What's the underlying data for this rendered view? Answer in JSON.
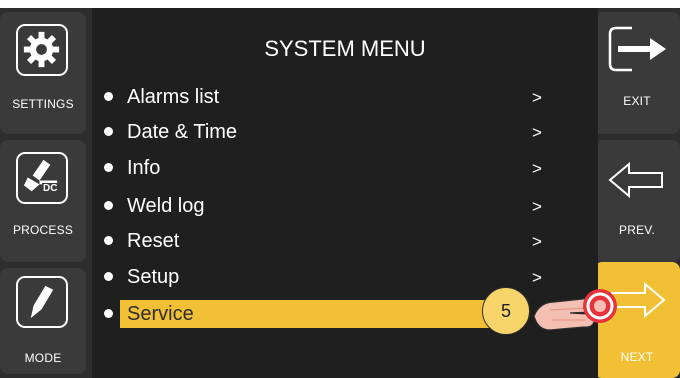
{
  "left_panel": {
    "settings_label": "SETTINGS",
    "process_label": "PROCESS",
    "process_badge": "DC",
    "mode_label": "MODE"
  },
  "right_panel": {
    "exit_label": "EXIT",
    "prev_label": "PREV.",
    "next_label": "NEXT"
  },
  "menu": {
    "title": "SYSTEM MENU",
    "items": [
      {
        "label": "Alarms list",
        "arrow": ">"
      },
      {
        "label": "Date & Time",
        "arrow": ">"
      },
      {
        "label": "Info",
        "arrow": ">"
      },
      {
        "label": "Weld log",
        "arrow": ">"
      },
      {
        "label": "Reset",
        "arrow": ">"
      },
      {
        "label": "Setup",
        "arrow": ">"
      },
      {
        "label": "Service"
      }
    ],
    "selected_item": "Service"
  },
  "callout": {
    "step_number": "5"
  },
  "colors": {
    "accent": "#f2c034",
    "panel": "#3a3a3a",
    "background": "#1f1f1f",
    "text": "#ffffff"
  }
}
